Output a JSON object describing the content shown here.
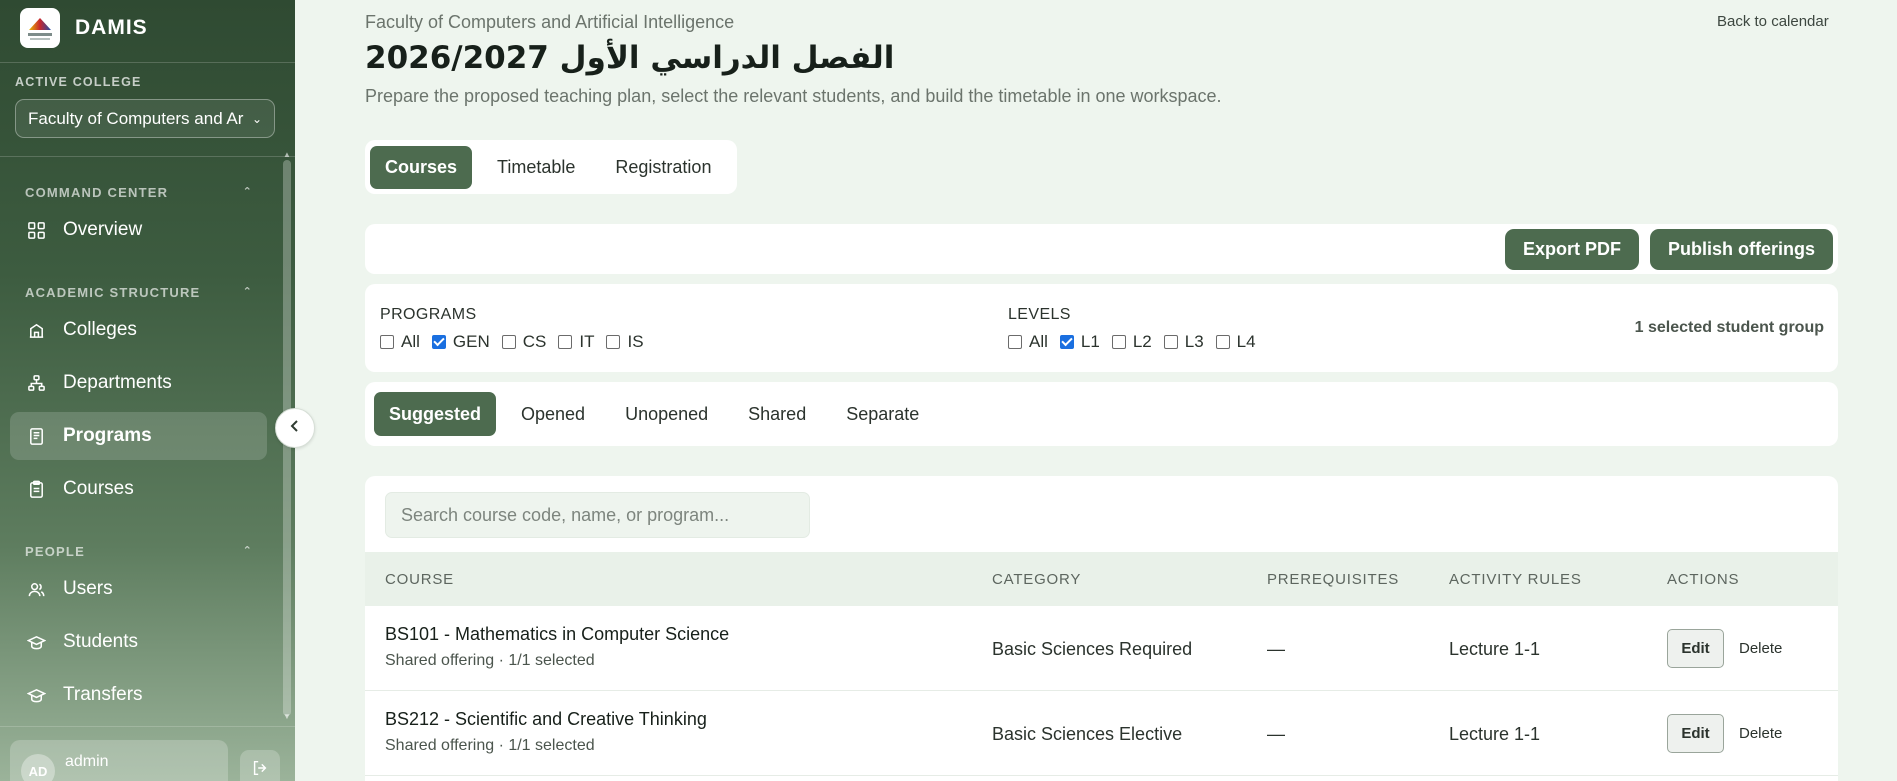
{
  "brand": {
    "name": "DAMIS"
  },
  "sidebar": {
    "active_college_label": "ACTIVE COLLEGE",
    "active_college_value": "Faculty of Computers and Ar",
    "groups": [
      {
        "label": "COMMAND CENTER",
        "items": [
          {
            "label": "Overview",
            "icon": "grid-icon"
          }
        ]
      },
      {
        "label": "ACADEMIC STRUCTURE",
        "items": [
          {
            "label": "Colleges",
            "icon": "building-icon"
          },
          {
            "label": "Departments",
            "icon": "hierarchy-icon"
          },
          {
            "label": "Programs",
            "icon": "book-icon",
            "active": true
          },
          {
            "label": "Courses",
            "icon": "clipboard-icon"
          }
        ]
      },
      {
        "label": "PEOPLE",
        "items": [
          {
            "label": "Users",
            "icon": "users-icon"
          },
          {
            "label": "Students",
            "icon": "graduation-cap-icon"
          },
          {
            "label": "Transfers",
            "icon": "graduation-cap-icon"
          }
        ]
      }
    ],
    "user": {
      "initials": "AD",
      "name": "admin"
    }
  },
  "header": {
    "breadcrumb": "Faculty of Computers and Artificial Intelligence",
    "title": "الفصل الدراسي الأول 2026/2027",
    "subtitle": "Prepare the proposed teaching plan, select the relevant students, and build the timetable in one workspace.",
    "back_link": "Back to calendar"
  },
  "tabs": [
    {
      "label": "Courses",
      "active": true
    },
    {
      "label": "Timetable"
    },
    {
      "label": "Registration"
    }
  ],
  "actions": {
    "export_label": "Export PDF",
    "publish_label": "Publish offerings"
  },
  "filters": {
    "programs_label": "PROGRAMS",
    "programs": [
      {
        "label": "All",
        "checked": false
      },
      {
        "label": "GEN",
        "checked": true
      },
      {
        "label": "CS",
        "checked": false
      },
      {
        "label": "IT",
        "checked": false
      },
      {
        "label": "IS",
        "checked": false
      }
    ],
    "levels_label": "LEVELS",
    "levels": [
      {
        "label": "All",
        "checked": false
      },
      {
        "label": "L1",
        "checked": true
      },
      {
        "label": "L2",
        "checked": false
      },
      {
        "label": "L3",
        "checked": false
      },
      {
        "label": "L4",
        "checked": false
      }
    ],
    "selected_summary": "1 selected student group"
  },
  "sub_tabs": [
    {
      "label": "Suggested",
      "active": true
    },
    {
      "label": "Opened"
    },
    {
      "label": "Unopened"
    },
    {
      "label": "Shared"
    },
    {
      "label": "Separate"
    }
  ],
  "table": {
    "search_placeholder": "Search course code, name, or program...",
    "columns": [
      "COURSE",
      "CATEGORY",
      "PREREQUISITES",
      "ACTIVITY RULES",
      "ACTIONS"
    ],
    "rows": [
      {
        "course": "BS101 - Mathematics in Computer Science",
        "meta": "Shared offering · 1/1 selected",
        "category": "Basic Sciences Required",
        "prerequisites": "—",
        "activity": "Lecture 1-1",
        "edit": "Edit",
        "delete": "Delete"
      },
      {
        "course": "BS212 - Scientific and Creative Thinking",
        "meta": "Shared offering · 1/1 selected",
        "category": "Basic Sciences Elective",
        "prerequisites": "—",
        "activity": "Lecture 1-1",
        "edit": "Edit",
        "delete": "Delete"
      }
    ]
  },
  "colors": {
    "accent": "#4d6b4f",
    "sidebar_top": "#2f4a32",
    "page_bg": "#eef5ee",
    "checkbox_checked": "#1a6fe0"
  }
}
